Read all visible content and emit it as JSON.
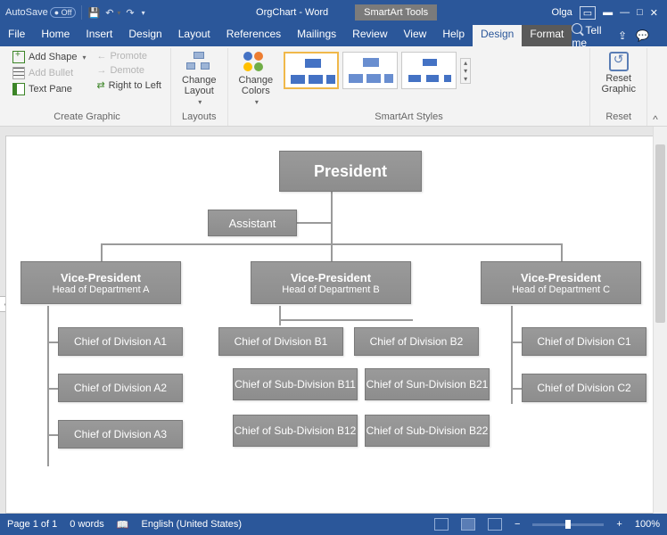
{
  "titlebar": {
    "autosave": "AutoSave",
    "doc_title": "OrgChart - Word",
    "tool_context": "SmartArt Tools",
    "user": "Olga"
  },
  "tabs": {
    "file": "File",
    "home": "Home",
    "insert": "Insert",
    "design1": "Design",
    "layout": "Layout",
    "references": "References",
    "mailings": "Mailings",
    "review": "Review",
    "view": "View",
    "help": "Help",
    "ctx_design": "Design",
    "ctx_format": "Format",
    "tellme": "Tell me"
  },
  "ribbon": {
    "create_graphic": {
      "label": "Create Graphic",
      "add_shape": "Add Shape",
      "add_bullet": "Add Bullet",
      "text_pane": "Text Pane",
      "promote": "Promote",
      "demote": "Demote",
      "rtl": "Right to Left"
    },
    "layouts": {
      "label": "Layouts",
      "change_layout": "Change\nLayout"
    },
    "styles": {
      "label": "SmartArt Styles",
      "change_colors": "Change\nColors"
    },
    "reset": {
      "label": "Reset",
      "reset_graphic": "Reset\nGraphic"
    }
  },
  "chart": {
    "president": "President",
    "assistant": "Assistant",
    "vp_a": {
      "title": "Vice-President",
      "sub": "Head of Department A"
    },
    "vp_b": {
      "title": "Vice-President",
      "sub": "Head of Department B"
    },
    "vp_c": {
      "title": "Vice-President",
      "sub": "Head of Department C"
    },
    "a1": "Chief of Division A1",
    "a2": "Chief of Division A2",
    "a3": "Chief of Division A3",
    "b1": "Chief of Division B1",
    "b2": "Chief of Division B2",
    "b11": "Chief of Sub-Division B11",
    "b12": "Chief of Sub-Division B12",
    "b21": "Chief of Sun-Division B21",
    "b22": "Chief of Sub-Division B22",
    "c1": "Chief of Division C1",
    "c2": "Chief of Division C2"
  },
  "status": {
    "page": "Page 1 of 1",
    "words": "0 words",
    "lang": "English (United States)",
    "zoom": "100%"
  }
}
